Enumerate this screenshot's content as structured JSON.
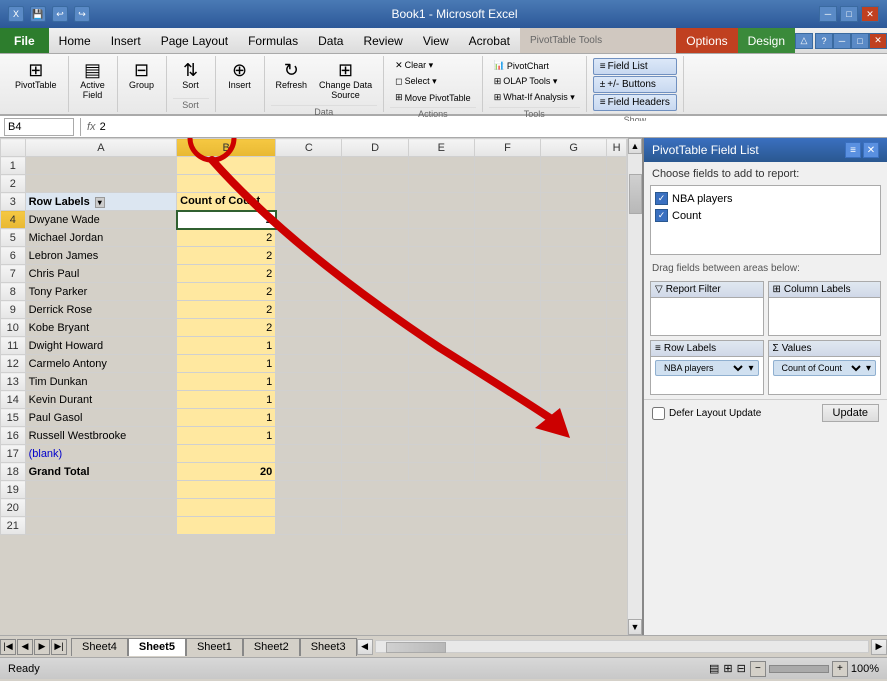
{
  "titleBar": {
    "title": "Book1 - Microsoft Excel",
    "quickAccess": [
      "save",
      "undo",
      "redo"
    ],
    "windowButtons": [
      "minimize",
      "restore",
      "close"
    ]
  },
  "menuBar": {
    "items": [
      "File",
      "Home",
      "Insert",
      "Page Layout",
      "Formulas",
      "Data",
      "Review",
      "View",
      "Acrobat"
    ],
    "contextTabs": [
      "Options",
      "Design"
    ],
    "contextLabel": "PivotTable Tools"
  },
  "ribbon": {
    "groups": [
      {
        "label": "",
        "items": [
          {
            "label": "PivotTable",
            "icon": "⊞",
            "type": "large"
          }
        ]
      },
      {
        "label": "",
        "items": [
          {
            "label": "Active\nField",
            "icon": "▤",
            "type": "large"
          }
        ]
      },
      {
        "label": "",
        "items": [
          {
            "label": "Group",
            "icon": "⊟",
            "type": "large"
          }
        ]
      },
      {
        "label": "Sort",
        "items": [
          {
            "label": "Sort",
            "icon": "⇅",
            "type": "large"
          }
        ]
      },
      {
        "label": "",
        "items": [
          {
            "label": "Insert",
            "icon": "⊕",
            "type": "large"
          }
        ]
      },
      {
        "label": "Data",
        "items": [
          {
            "label": "Refresh",
            "icon": "↻",
            "type": "large"
          },
          {
            "label": "Change Data\nSource",
            "icon": "⊞",
            "type": "large"
          }
        ]
      },
      {
        "label": "Actions",
        "items": [
          {
            "label": "Clear",
            "icon": "✕",
            "type": "small"
          },
          {
            "label": "Select",
            "icon": "◻",
            "type": "small"
          },
          {
            "label": "Move PivotTable",
            "icon": "⊞",
            "type": "small"
          }
        ]
      },
      {
        "label": "Tools",
        "items": [
          {
            "label": "PivotChart",
            "icon": "📊",
            "type": "small"
          },
          {
            "label": "OLAP Tools",
            "icon": "⊞",
            "type": "small"
          },
          {
            "label": "What-If Analysis",
            "icon": "⊞",
            "type": "small"
          }
        ]
      },
      {
        "label": "Show",
        "items": [
          {
            "label": "Field List",
            "icon": "≡",
            "type": "small",
            "active": true
          },
          {
            "label": "+/- Buttons",
            "icon": "±",
            "type": "small",
            "active": true
          },
          {
            "label": "Field Headers",
            "icon": "≡",
            "type": "small",
            "active": true
          }
        ]
      }
    ]
  },
  "formulaBar": {
    "cellRef": "B4",
    "formula": "2"
  },
  "spreadsheet": {
    "selectedCell": "B4",
    "columns": [
      "A",
      "B",
      "C",
      "D",
      "E",
      "F",
      "G",
      "H"
    ],
    "rows": [
      {
        "num": 1,
        "cells": [
          "",
          "",
          "",
          "",
          "",
          "",
          "",
          ""
        ]
      },
      {
        "num": 2,
        "cells": [
          "",
          "",
          "",
          "",
          "",
          "",
          "",
          ""
        ]
      },
      {
        "num": 3,
        "cells": [
          "Row Labels",
          "Count of Count",
          "",
          "",
          "",
          "",
          "",
          ""
        ],
        "type": "header"
      },
      {
        "num": 4,
        "cells": [
          "Dwyane Wade",
          "2",
          "",
          "",
          "",
          "",
          "",
          ""
        ],
        "selected": true
      },
      {
        "num": 5,
        "cells": [
          "Michael Jordan",
          "2",
          "",
          "",
          "",
          "",
          "",
          ""
        ]
      },
      {
        "num": 6,
        "cells": [
          "Lebron James",
          "2",
          "",
          "",
          "",
          "",
          "",
          ""
        ]
      },
      {
        "num": 7,
        "cells": [
          "Chris Paul",
          "2",
          "",
          "",
          "",
          "",
          "",
          ""
        ]
      },
      {
        "num": 8,
        "cells": [
          "Tony Parker",
          "2",
          "",
          "",
          "",
          "",
          "",
          ""
        ]
      },
      {
        "num": 9,
        "cells": [
          "Derrick Rose",
          "2",
          "",
          "",
          "",
          "",
          "",
          ""
        ]
      },
      {
        "num": 10,
        "cells": [
          "Kobe Bryant",
          "2",
          "",
          "",
          "",
          "",
          "",
          ""
        ]
      },
      {
        "num": 11,
        "cells": [
          "Dwight Howard",
          "1",
          "",
          "",
          "",
          "",
          "",
          ""
        ]
      },
      {
        "num": 12,
        "cells": [
          "Carmelo Antony",
          "1",
          "",
          "",
          "",
          "",
          "",
          ""
        ]
      },
      {
        "num": 13,
        "cells": [
          "Tim Dunkan",
          "1",
          "",
          "",
          "",
          "",
          "",
          ""
        ]
      },
      {
        "num": 14,
        "cells": [
          "Kevin Durant",
          "1",
          "",
          "",
          "",
          "",
          "",
          ""
        ]
      },
      {
        "num": 15,
        "cells": [
          "Paul Gasol",
          "1",
          "",
          "",
          "",
          "",
          "",
          ""
        ]
      },
      {
        "num": 16,
        "cells": [
          "Russell Westbrooke",
          "1",
          "",
          "",
          "",
          "",
          "",
          ""
        ]
      },
      {
        "num": 17,
        "cells": [
          "(blank)",
          "",
          "",
          "",
          "",
          "",
          "",
          ""
        ],
        "type": "blank"
      },
      {
        "num": 18,
        "cells": [
          "Grand Total",
          "20",
          "",
          "",
          "",
          "",
          "",
          ""
        ],
        "type": "grand"
      },
      {
        "num": 19,
        "cells": [
          "",
          "",
          "",
          "",
          "",
          "",
          "",
          ""
        ]
      },
      {
        "num": 20,
        "cells": [
          "",
          "",
          "",
          "",
          "",
          "",
          "",
          ""
        ]
      },
      {
        "num": 21,
        "cells": [
          "",
          "",
          "",
          "",
          "",
          "",
          "",
          ""
        ]
      }
    ]
  },
  "pivotPanel": {
    "title": "PivotTable Field List",
    "fieldsLabel": "Choose fields to add to report:",
    "fields": [
      {
        "name": "NBA players",
        "checked": true
      },
      {
        "name": "Count",
        "checked": true
      }
    ],
    "dragLabel": "Drag fields between areas below:",
    "areas": {
      "reportFilter": {
        "label": "Report Filter",
        "icon": "▽",
        "tags": []
      },
      "columnLabels": {
        "label": "Column Labels",
        "icon": "⊞",
        "tags": []
      },
      "rowLabels": {
        "label": "Row Labels",
        "icon": "≡",
        "tags": [
          {
            "name": "NBA players"
          }
        ]
      },
      "values": {
        "label": "Values",
        "icon": "Σ",
        "tags": [
          {
            "name": "Count of Count"
          }
        ]
      }
    },
    "deferLabel": "Defer Layout Update",
    "updateBtn": "Update"
  },
  "sheetTabs": {
    "tabs": [
      "Sheet4",
      "Sheet5",
      "Sheet1",
      "Sheet2",
      "Sheet3"
    ],
    "activeTab": "Sheet5"
  },
  "statusBar": {
    "status": "Ready",
    "zoom": "100%",
    "viewButtons": [
      "normal",
      "page-layout",
      "page-break"
    ]
  },
  "annotation": {
    "circleLabel": "Sort button circled",
    "arrowLabel": "Arrow pointing to pivot table"
  }
}
